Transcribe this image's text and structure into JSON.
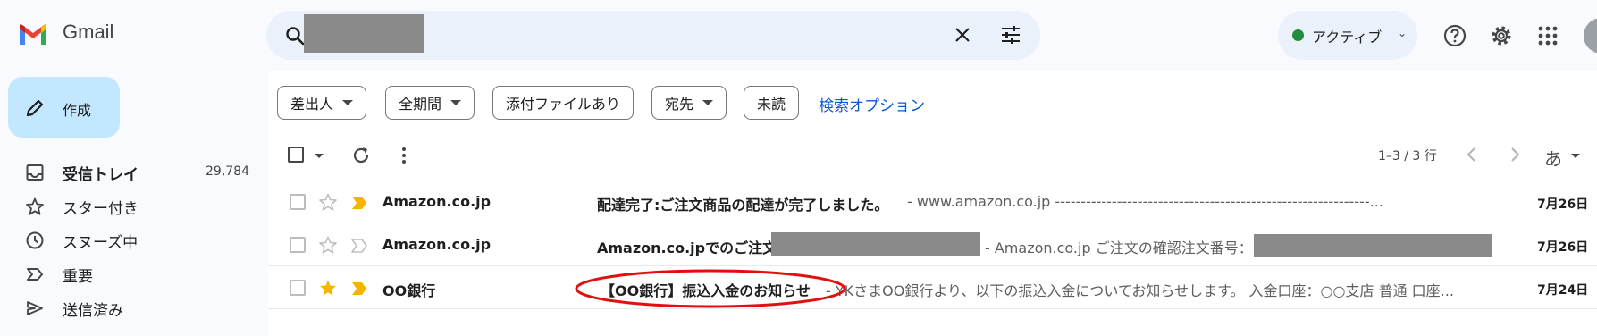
{
  "app": {
    "name": "Gmail"
  },
  "search": {
    "query_redacted": true
  },
  "header": {
    "status_label": "アクティブ",
    "status_color": "#1e8e3e",
    "icons": [
      "help-icon",
      "gear-icon",
      "apps-icon",
      "avatar"
    ]
  },
  "compose": {
    "label": "作成"
  },
  "sidebar": {
    "items": [
      {
        "label": "受信トレイ",
        "count": "29,784",
        "icon": "inbox-icon",
        "active": true
      },
      {
        "label": "スター付き",
        "icon": "star-icon"
      },
      {
        "label": "スヌーズ中",
        "icon": "clock-icon"
      },
      {
        "label": "重要",
        "icon": "important-icon"
      },
      {
        "label": "送信済み",
        "icon": "send-icon"
      }
    ]
  },
  "filters": {
    "chips": [
      {
        "label": "差出人",
        "dropdown": true
      },
      {
        "label": "全期間",
        "dropdown": true
      },
      {
        "label": "添付ファイルあり",
        "dropdown": false
      },
      {
        "label": "宛先",
        "dropdown": true
      },
      {
        "label": "未読",
        "dropdown": false
      }
    ],
    "advanced_link": "検索オプション"
  },
  "toolbar": {
    "page_info": "1–3 / 3 行",
    "ime_label": "あ"
  },
  "emails": [
    {
      "sender": "Amazon.co.jp",
      "subject": "配達完了:ご注文商品の配達が完了しました。",
      "snippet": "- www.amazon.co.jp -------------------------------------------------------------...",
      "date": "7月26日",
      "starred": false,
      "important": true
    },
    {
      "sender": "Amazon.co.jp",
      "subject": "Amazon.co.jpでのご注文",
      "snippet": "- Amazon.co.jp ご注文の確認注文番号：",
      "date": "7月26日",
      "starred": false,
      "important": false
    },
    {
      "sender": "OO銀行",
      "subject": "【OO銀行】振込入金のお知らせ",
      "snippet": "- YKさまOO銀行より、以下の振込入金についてお知らせします。 入金口座：○○支店 普通 口座...",
      "date": "7月24日",
      "starred": true,
      "important": true
    }
  ],
  "colors": {
    "accent_blue": "#0b57d0",
    "compose_bg": "#c2e7ff",
    "search_bg": "#eaf1fb",
    "star_yellow": "#f4b400",
    "annotation_red": "#e01010"
  }
}
